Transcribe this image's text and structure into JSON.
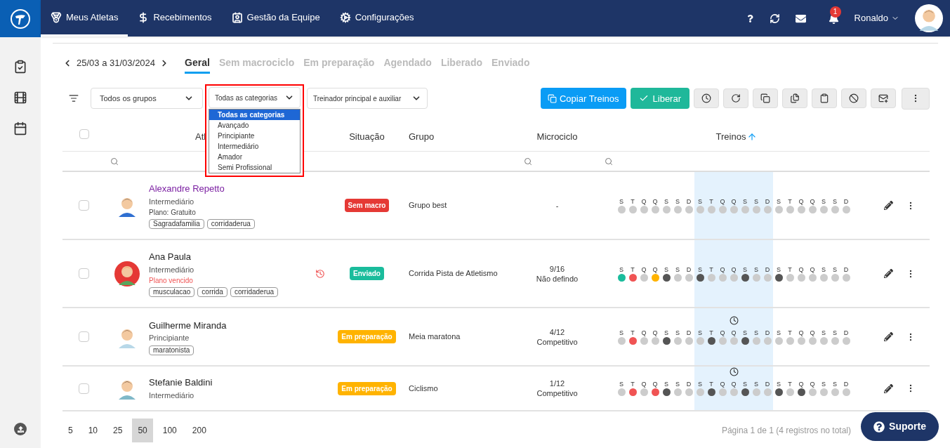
{
  "nav": {
    "items": [
      {
        "label": "Meus Atletas",
        "selected": true
      },
      {
        "label": "Recebimentos",
        "selected": false
      },
      {
        "label": "Gestão da Equipe",
        "selected": false
      },
      {
        "label": "Configurações",
        "selected": false
      }
    ],
    "notifications": "1",
    "user": "Ronaldo"
  },
  "period": "25/03 a 31/03/2024",
  "tabs": [
    {
      "label": "Geral",
      "selected": true
    },
    {
      "label": "Sem macrociclo",
      "selected": false
    },
    {
      "label": "Em preparação",
      "selected": false
    },
    {
      "label": "Agendado",
      "selected": false
    },
    {
      "label": "Liberado",
      "selected": false
    },
    {
      "label": "Enviado",
      "selected": false
    }
  ],
  "filters": {
    "groups": "Todos os grupos",
    "categories": "Todas as categorias",
    "coach": "Treinador principal e auxiliar",
    "category_options": [
      {
        "label": "Todas as categorias",
        "selected": true
      },
      {
        "label": "Avançado",
        "selected": false
      },
      {
        "label": "Principiante",
        "selected": false
      },
      {
        "label": "Intermediário",
        "selected": false
      },
      {
        "label": "Amador",
        "selected": false
      },
      {
        "label": "Semi Profissional",
        "selected": false
      }
    ]
  },
  "actions": {
    "copy": "Copiar Treinos",
    "release": "Liberar"
  },
  "table": {
    "select_all_checked": false,
    "columns": {
      "athlete": "Atl",
      "status": "Situação",
      "group": "Grupo",
      "microcycle": "Microciclo",
      "trainings": "Treinos"
    },
    "rows": [
      {
        "checked": false,
        "name": "Alexandre Repetto",
        "visited": true,
        "category": "Intermediário",
        "plan": "Plano: Gratuito",
        "plan_expired": false,
        "renewal_alert": false,
        "tags": [
          "Sagradafamilia",
          "corridaderua"
        ],
        "status": {
          "label": "Sem macro",
          "kind": "sem_macro"
        },
        "group": "Grupo best",
        "microcycle": [
          "-"
        ],
        "weeks": [
          {
            "current": false,
            "days": [
              {
                "letter": "S",
                "color": "#cccccc"
              },
              {
                "letter": "T",
                "color": "#cccccc"
              },
              {
                "letter": "Q",
                "color": "#cccccc"
              },
              {
                "letter": "Q",
                "color": "#cccccc"
              },
              {
                "letter": "S",
                "color": "#cccccc"
              },
              {
                "letter": "S",
                "color": "#cccccc"
              },
              {
                "letter": "D",
                "color": "#cccccc"
              }
            ]
          },
          {
            "current": true,
            "days": [
              {
                "letter": "S",
                "color": "#cccccc"
              },
              {
                "letter": "T",
                "color": "#cccccc"
              },
              {
                "letter": "Q",
                "color": "#cccccc"
              },
              {
                "letter": "Q",
                "color": "#cccccc"
              },
              {
                "letter": "S",
                "color": "#cccccc"
              },
              {
                "letter": "S",
                "color": "#cccccc"
              },
              {
                "letter": "D",
                "color": "#cccccc"
              }
            ]
          },
          {
            "current": false,
            "days": [
              {
                "letter": "S",
                "color": "#cccccc"
              },
              {
                "letter": "T",
                "color": "#cccccc"
              },
              {
                "letter": "Q",
                "color": "#cccccc"
              },
              {
                "letter": "Q",
                "color": "#cccccc"
              },
              {
                "letter": "S",
                "color": "#cccccc"
              },
              {
                "letter": "S",
                "color": "#cccccc"
              },
              {
                "letter": "D",
                "color": "#cccccc"
              }
            ]
          }
        ]
      },
      {
        "checked": false,
        "name": "Ana Paula",
        "visited": false,
        "category": "Intermediário",
        "plan": "Plano vencido",
        "plan_expired": true,
        "renewal_alert": true,
        "tags": [
          "musculacao",
          "corrida",
          "corridaderua"
        ],
        "status": {
          "label": "Enviado",
          "kind": "enviado"
        },
        "group": "Corrida Pista de Atletismo",
        "microcycle": [
          "9/16",
          "Não defindo"
        ],
        "weeks": [
          {
            "current": false,
            "days": [
              {
                "letter": "S",
                "color": "#1abc9c"
              },
              {
                "letter": "T",
                "color": "#f05454"
              },
              {
                "letter": "Q",
                "color": "#cccccc"
              },
              {
                "letter": "Q",
                "color": "#ffb300"
              },
              {
                "letter": "S",
                "color": "#555555"
              },
              {
                "letter": "S",
                "color": "#cccccc"
              },
              {
                "letter": "D",
                "color": "#cccccc"
              }
            ]
          },
          {
            "current": true,
            "days": [
              {
                "letter": "S",
                "color": "#555555"
              },
              {
                "letter": "T",
                "color": "#cccccc"
              },
              {
                "letter": "Q",
                "color": "#cccccc"
              },
              {
                "letter": "Q",
                "color": "#cccccc"
              },
              {
                "letter": "S",
                "color": "#555555"
              },
              {
                "letter": "S",
                "color": "#cccccc"
              },
              {
                "letter": "D",
                "color": "#cccccc"
              }
            ]
          },
          {
            "current": false,
            "days": [
              {
                "letter": "S",
                "color": "#555555"
              },
              {
                "letter": "T",
                "color": "#cccccc"
              },
              {
                "letter": "Q",
                "color": "#cccccc"
              },
              {
                "letter": "Q",
                "color": "#cccccc"
              },
              {
                "letter": "S",
                "color": "#cccccc"
              },
              {
                "letter": "S",
                "color": "#cccccc"
              },
              {
                "letter": "D",
                "color": "#cccccc"
              }
            ]
          }
        ]
      },
      {
        "checked": false,
        "name": "Guilherme Miranda",
        "visited": false,
        "category": "Principiante",
        "renewal_alert": false,
        "tags": [
          "maratonista"
        ],
        "status": {
          "label": "Em preparação",
          "kind": "em_preparacao"
        },
        "group": "Meia maratona",
        "microcycle": [
          "4/12",
          "Competitivo"
        ],
        "weeks": [
          {
            "current": false,
            "days": [
              {
                "letter": "S",
                "color": "#cccccc"
              },
              {
                "letter": "T",
                "color": "#f05454"
              },
              {
                "letter": "Q",
                "color": "#cccccc"
              },
              {
                "letter": "Q",
                "color": "#cccccc"
              },
              {
                "letter": "S",
                "color": "#555555"
              },
              {
                "letter": "S",
                "color": "#cccccc"
              },
              {
                "letter": "D",
                "color": "#cccccc"
              }
            ]
          },
          {
            "current": true,
            "days": [
              {
                "letter": "S",
                "color": "#cccccc"
              },
              {
                "letter": "T",
                "color": "#555555"
              },
              {
                "letter": "Q",
                "color": "#cccccc"
              },
              {
                "letter": "Q",
                "color": "#cccccc",
                "scheduled": true
              },
              {
                "letter": "S",
                "color": "#555555"
              },
              {
                "letter": "S",
                "color": "#cccccc"
              },
              {
                "letter": "D",
                "color": "#cccccc"
              }
            ]
          },
          {
            "current": false,
            "days": [
              {
                "letter": "S",
                "color": "#cccccc"
              },
              {
                "letter": "T",
                "color": "#cccccc"
              },
              {
                "letter": "Q",
                "color": "#cccccc"
              },
              {
                "letter": "Q",
                "color": "#cccccc"
              },
              {
                "letter": "S",
                "color": "#cccccc"
              },
              {
                "letter": "S",
                "color": "#cccccc"
              },
              {
                "letter": "D",
                "color": "#cccccc"
              }
            ]
          }
        ]
      },
      {
        "checked": false,
        "name": "Stefanie Baldini",
        "visited": false,
        "category": "Intermediário",
        "renewal_alert": false,
        "status": {
          "label": "Em preparação",
          "kind": "em_preparacao"
        },
        "group": "Ciclismo",
        "microcycle": [
          "1/12",
          "Competitivo"
        ],
        "weeks": [
          {
            "current": false,
            "days": [
              {
                "letter": "S",
                "color": "#cccccc"
              },
              {
                "letter": "T",
                "color": "#f05454"
              },
              {
                "letter": "Q",
                "color": "#cccccc"
              },
              {
                "letter": "Q",
                "color": "#f05454"
              },
              {
                "letter": "S",
                "color": "#555555"
              },
              {
                "letter": "S",
                "color": "#cccccc"
              },
              {
                "letter": "D",
                "color": "#cccccc"
              }
            ]
          },
          {
            "current": true,
            "days": [
              {
                "letter": "S",
                "color": "#cccccc"
              },
              {
                "letter": "T",
                "color": "#555555"
              },
              {
                "letter": "Q",
                "color": "#cccccc"
              },
              {
                "letter": "Q",
                "color": "#cccccc",
                "scheduled": true
              },
              {
                "letter": "S",
                "color": "#555555"
              },
              {
                "letter": "S",
                "color": "#cccccc"
              },
              {
                "letter": "D",
                "color": "#cccccc"
              }
            ]
          },
          {
            "current": false,
            "days": [
              {
                "letter": "S",
                "color": "#555555"
              },
              {
                "letter": "T",
                "color": "#cccccc"
              },
              {
                "letter": "Q",
                "color": "#555555"
              },
              {
                "letter": "Q",
                "color": "#cccccc"
              },
              {
                "letter": "S",
                "color": "#cccccc"
              },
              {
                "letter": "S",
                "color": "#cccccc"
              },
              {
                "letter": "D",
                "color": "#cccccc"
              }
            ]
          }
        ]
      }
    ]
  },
  "pagination": {
    "sizes": [
      {
        "label": "5",
        "selected": false
      },
      {
        "label": "10",
        "selected": false
      },
      {
        "label": "25",
        "selected": false
      },
      {
        "label": "50",
        "selected": true
      },
      {
        "label": "100",
        "selected": false
      },
      {
        "label": "200",
        "selected": false
      }
    ],
    "summary": "Página 1 de 1 (4 registros no total)"
  },
  "support": "Suporte"
}
